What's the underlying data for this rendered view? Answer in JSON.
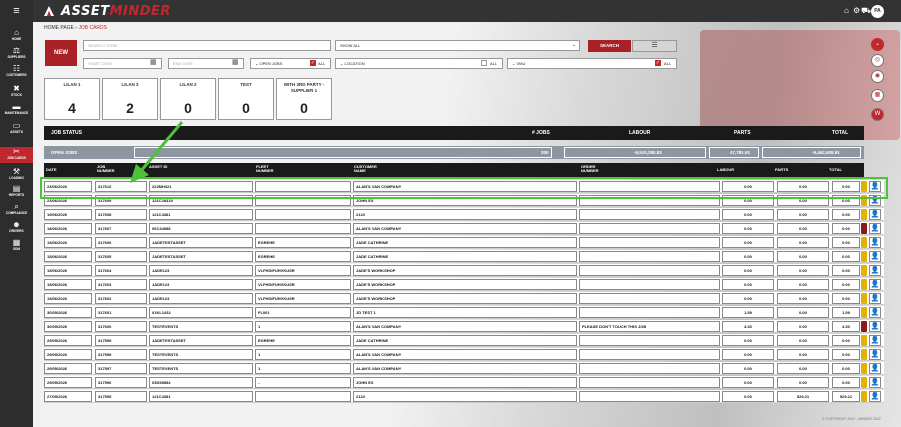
{
  "app": {
    "logo_left": "ASSET",
    "logo_right": "MINDER",
    "avatar": "PA"
  },
  "sidebar": [
    {
      "label": "",
      "icon": "menu-icon"
    },
    {
      "label": "HOME",
      "icon": "home-icon"
    },
    {
      "label": "SUPPLIERS",
      "icon": "suppliers-icon"
    },
    {
      "label": "CUSTOMERS",
      "icon": "customers-icon"
    },
    {
      "label": "STOCK",
      "icon": "stock-icon"
    },
    {
      "label": "MAINTENANCE",
      "icon": "maintenance-icon"
    },
    {
      "label": "ASSETS",
      "icon": "assets-icon"
    },
    {
      "label": "JOB CARDS",
      "icon": "jobcards-icon"
    },
    {
      "label": "LOADING",
      "icon": "loading-icon"
    },
    {
      "label": "REPORTS",
      "icon": "reports-icon"
    },
    {
      "label": "COMPLIANCE",
      "icon": "compliance-icon"
    },
    {
      "label": "DRIVERS",
      "icon": "drivers-icon"
    },
    {
      "label": "SDM",
      "icon": "sdm-icon"
    }
  ],
  "breadcrumb": {
    "home": "HOME PAGE",
    "sep": " › ",
    "current": "JOB CARDS"
  },
  "toolbar": {
    "new_label": "NEW",
    "search_placeholder": "SEARCH TERM",
    "show_all": "SHOW ALL",
    "search_label": "SEARCH",
    "start_date": "START DATE",
    "end_date": "END DATE",
    "open_jobs": "OPEN JOBS",
    "all": "ALL",
    "location": "LOCATION",
    "vmu": "VMU"
  },
  "cards": [
    {
      "title": "LILAN 1",
      "value": "4"
    },
    {
      "title": "LILAN 3",
      "value": "2"
    },
    {
      "title": "LILAN 2",
      "value": "0"
    },
    {
      "title": "TEST",
      "value": "0"
    },
    {
      "title": "WITH 3RD PARTY - SUPPLIER 1",
      "value": "0"
    }
  ],
  "status": {
    "job_status": "JOB STATUS",
    "jobs": "# JOBS",
    "labour": "LABOUR",
    "parts": "PARTS",
    "total": "TOTAL"
  },
  "open_jobs": {
    "label": "OPEN JOBS",
    "jobs": "200",
    "labour": "-9,510,280.83",
    "parts": "47,781.91",
    "total": "-9,462,608.91"
  },
  "columns": {
    "date": "DATE",
    "job": "JOB NUMBER",
    "asset": "ASSET ID",
    "fleet": "FLEET NUMBER",
    "customer": "CUSTOMER NAME",
    "order": "ORDER NUMBER",
    "labour": "LABOUR",
    "parts": "PARTS",
    "total": "TOTAL"
  },
  "rows": [
    {
      "date": "23/06/2026",
      "job": "317610",
      "asset": "222MH321",
      "fleet": "",
      "customer": "ALAN'S VAN COMPANY",
      "order": "",
      "labour": "0.00",
      "parts": "0.00",
      "total": "0.00",
      "status": "yellow",
      "user": "yellow"
    },
    {
      "date": "23/06/2026",
      "job": "317609",
      "asset": "121C28319",
      "fleet": "",
      "customer": "JOHN EX",
      "order": "",
      "labour": "0.00",
      "parts": "0.00",
      "total": "0.00",
      "status": "yellow",
      "user": "yellow"
    },
    {
      "date": "19/06/2026",
      "job": "317608",
      "asset": "121C4381",
      "fleet": "",
      "customer": "2124",
      "order": "",
      "labour": "0.00",
      "parts": "0.00",
      "total": "0.00",
      "status": "yellow",
      "user": "yellow"
    },
    {
      "date": "18/06/2026",
      "job": "317607",
      "asset": "06C34988",
      "fleet": "",
      "customer": "ALAN'S VAN COMPANY",
      "order": "",
      "labour": "0.00",
      "parts": "0.00",
      "total": "0.00",
      "status": "red",
      "user": "yellow"
    },
    {
      "date": "15/06/2026",
      "job": "317606",
      "asset": "JADETESTASSET",
      "fleet": "EGREHE",
      "customer": "JADE CATHRINE",
      "order": "",
      "labour": "0.00",
      "parts": "0.00",
      "total": "0.00",
      "status": "yellow",
      "user": "green"
    },
    {
      "date": "15/06/2026",
      "job": "317605",
      "asset": "JADETESTASSET",
      "fleet": "EGREHE",
      "customer": "JADE CATHRINE",
      "order": "",
      "labour": "0.00",
      "parts": "0.00",
      "total": "0.00",
      "status": "yellow",
      "user": "yellow"
    },
    {
      "date": "15/06/2026",
      "job": "317604",
      "asset": "JADE123",
      "fleet": "VLFHDIFUHVKUSR",
      "customer": "JADE'S WORKSHOP",
      "order": "",
      "labour": "0.00",
      "parts": "0.00",
      "total": "0.00",
      "status": "yellow",
      "user": "blue"
    },
    {
      "date": "15/06/2026",
      "job": "317603",
      "asset": "JADE123",
      "fleet": "VLFHDIFUHVKUSR",
      "customer": "JADE'S WORKSHOP",
      "order": "",
      "labour": "0.00",
      "parts": "0.00",
      "total": "0.00",
      "status": "yellow",
      "user": "blue"
    },
    {
      "date": "15/06/2026",
      "job": "317602",
      "asset": "JADE123",
      "fleet": "VLFHDIFUHVKUSR",
      "customer": "JADE'S WORKSHOP",
      "order": "",
      "labour": "0.00",
      "parts": "0.00",
      "total": "0.00",
      "status": "yellow",
      "user": "blue"
    },
    {
      "date": "30/05/2026",
      "job": "317601",
      "asset": "01KL1432",
      "fleet": "FL001",
      "customer": "JD TEST 1",
      "order": "",
      "labour": "1.59",
      "parts": "0.00",
      "total": "1.59",
      "status": "yellow",
      "user": "blue"
    },
    {
      "date": "30/05/2026",
      "job": "317600",
      "asset": "TESTEVENTS",
      "fleet": "1",
      "customer": "ALAN'S VAN COMPANY",
      "order": "PLEASE DON'T TOUCH THIS JOB",
      "labour": "4.30",
      "parts": "0.00",
      "total": "4.30",
      "status": "red",
      "user": "blue"
    },
    {
      "date": "29/05/2026",
      "job": "317599",
      "asset": "JADETESTASSET",
      "fleet": "EGREHE",
      "customer": "JADE CATHRINE",
      "order": "",
      "labour": "0.00",
      "parts": "0.00",
      "total": "0.00",
      "status": "yellow",
      "user": "yellow"
    },
    {
      "date": "29/05/2026",
      "job": "317598",
      "asset": "TESTEVENTS",
      "fleet": "1",
      "customer": "ALAN'S VAN COMPANY",
      "order": "",
      "labour": "0.00",
      "parts": "0.00",
      "total": "0.00",
      "status": "yellow",
      "user": "yellow"
    },
    {
      "date": "29/05/2026",
      "job": "317597",
      "asset": "TESTEVENTS",
      "fleet": "1",
      "customer": "ALAN'S VAN COMPANY",
      "order": "",
      "labour": "0.00",
      "parts": "0.00",
      "total": "0.00",
      "status": "yellow",
      "user": "yellow"
    },
    {
      "date": "29/05/2026",
      "job": "317596",
      "asset": "03D98584",
      "fleet": "..",
      "customer": "JOHN EX",
      "order": "",
      "labour": "0.00",
      "parts": "0.00",
      "total": "0.00",
      "status": "yellow",
      "user": "yellow"
    },
    {
      "date": "27/05/2026",
      "job": "317595",
      "asset": "121C4381",
      "fleet": "",
      "customer": "2124",
      "order": "",
      "labour": "0.00",
      "parts": "529.21",
      "total": "529.21",
      "status": "yellow",
      "user": "yellow"
    }
  ],
  "copyright": "© COPYRIGHT 2022 - MINDER 2022",
  "colors": {
    "brand": "#c0282d",
    "highlight": "#4ec03a",
    "status_yellow": "#e1b300",
    "status_red": "#8b1a1a"
  }
}
